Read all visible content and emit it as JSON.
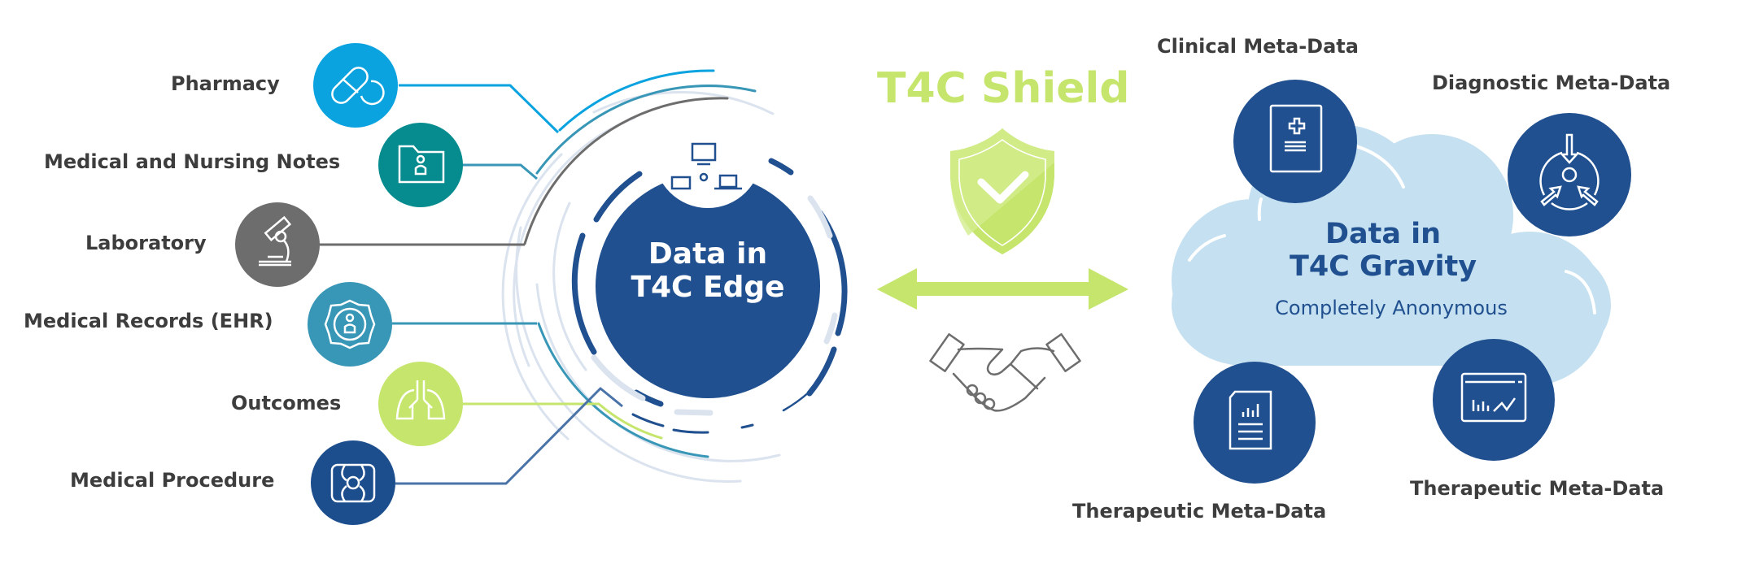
{
  "title": "T4C Shield",
  "colors": {
    "navy": "#20508f",
    "lime": "#c5e56c",
    "cloud": "#c5e0f0",
    "text": "#3d3d3d",
    "ring_light": "#dbe3ef"
  },
  "edge": {
    "title_line1": "Data in",
    "title_line2": "T4C Edge",
    "icon": "network-devices-icon"
  },
  "sources": [
    {
      "label": "Pharmacy",
      "icon": "pill-capsule-icon",
      "color": "#0aa3df"
    },
    {
      "label": "Medical and Nursing Notes",
      "icon": "patient-folder-icon",
      "color": "#068b8f"
    },
    {
      "label": "Laboratory",
      "icon": "microscope-icon",
      "color": "#6d6d6d"
    },
    {
      "label": "Medical Records (EHR)",
      "icon": "patient-badge-icon",
      "color": "#3896b6"
    },
    {
      "label": "Outcomes",
      "icon": "lungs-icon",
      "color": "#c5e56c"
    },
    {
      "label": "Medical Procedure",
      "icon": "knee-joint-icon",
      "color": "#1c4e8e"
    }
  ],
  "shield": {
    "title": "T4C Shield",
    "icon": "shield-check-icon",
    "arrow": "double-arrow-icon",
    "handshake": "handshake-icon"
  },
  "gravity": {
    "title_line1": "Data in",
    "title_line2": "T4C Gravity",
    "subtitle": "Completely Anonymous"
  },
  "metadata": [
    {
      "label": "Clinical Meta-Data",
      "icon": "medical-document-icon"
    },
    {
      "label": "Diagnostic Meta-Data",
      "icon": "diagnostic-cycle-icon"
    },
    {
      "label": "Therapeutic Meta-Data",
      "icon": "report-chart-icon"
    },
    {
      "label": "Therapeutic Meta-Data",
      "icon": "dashboard-chart-icon"
    }
  ]
}
